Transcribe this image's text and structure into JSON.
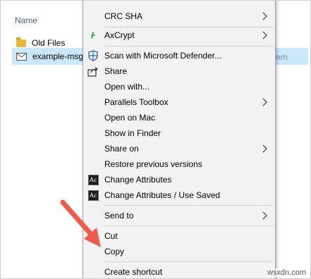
{
  "explorer": {
    "column_header": "Name",
    "files": [
      {
        "name": "Old Files",
        "icon": "folder-icon"
      },
      {
        "name": "example-msg",
        "icon": "mail-icon"
      }
    ],
    "right_fragment": "em"
  },
  "context_menu": {
    "items": [
      {
        "label": "CRC SHA",
        "icon": "",
        "submenu": true
      },
      {
        "label": "AxCrypt",
        "icon": "axcrypt-icon",
        "submenu": true
      },
      {
        "label": "Scan with Microsoft Defender...",
        "icon": "defender-icon",
        "submenu": false
      },
      {
        "label": "Share",
        "icon": "share-icon",
        "submenu": false
      },
      {
        "label": "Open with...",
        "icon": "",
        "submenu": false
      },
      {
        "label": "Parallels Toolbox",
        "icon": "",
        "submenu": true
      },
      {
        "label": "Open on Mac",
        "icon": "",
        "submenu": false
      },
      {
        "label": "Show in Finder",
        "icon": "",
        "submenu": false
      },
      {
        "label": "Share on",
        "icon": "",
        "submenu": true
      },
      {
        "label": "Restore previous versions",
        "icon": "",
        "submenu": false
      },
      {
        "label": "Change Attributes",
        "icon": "attributes-icon",
        "submenu": false
      },
      {
        "label": "Change Attributes / Use Saved",
        "icon": "attributes-icon",
        "submenu": false
      },
      {
        "label": "Send to",
        "icon": "",
        "submenu": true
      },
      {
        "label": "Cut",
        "icon": "",
        "submenu": false
      },
      {
        "label": "Copy",
        "icon": "",
        "submenu": false
      },
      {
        "label": "Create shortcut",
        "icon": "",
        "submenu": false
      }
    ],
    "ac_icon_text": "Ac"
  },
  "annotation": {
    "arrow_color": "#f05a4a",
    "points_to": "Copy"
  },
  "watermark": "wsxdn.com",
  "colors": {
    "selection": "#cce8ff",
    "menu_bg": "#f2f2f2",
    "header_text": "#4c607a"
  }
}
